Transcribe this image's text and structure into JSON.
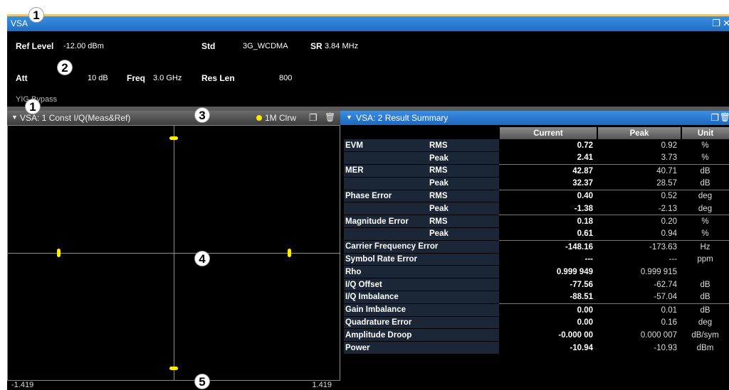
{
  "window": {
    "title": "VSA"
  },
  "header": {
    "ref_level_label": "Ref Level",
    "ref_level_value": "-12.00 dBm",
    "std_label": "Std",
    "std_value": "3G_WCDMA",
    "sr_label": "SR",
    "sr_value": "3.84 MHz",
    "att_label": "Att",
    "att_value": "10 dB",
    "freq_label": "Freq",
    "freq_value": "3.0 GHz",
    "res_len_label": "Res Len",
    "res_len_value": "800",
    "yig_text": "YIG Bypass"
  },
  "left_panel": {
    "title": "VSA: 1 Const I/Q(Meas&Ref)",
    "trace_tag": "1M Clrw",
    "x_min": "-1.419",
    "x_max": "1.419",
    "constellation_points": [
      {
        "i": 0.0,
        "q": 1.0
      },
      {
        "i": 0.0,
        "q": -1.0
      },
      {
        "i": -1.0,
        "q": 0.0
      },
      {
        "i": 1.0,
        "q": 0.0
      }
    ],
    "point_color": "#ffee00"
  },
  "right_panel": {
    "title": "VSA: 2 Result Summary",
    "columns": [
      "Current",
      "Peak",
      "Unit"
    ],
    "rows": [
      {
        "name": "EVM",
        "sub": "RMS",
        "current": "0.72",
        "peak": "0.92",
        "unit": "%"
      },
      {
        "name": "",
        "sub": "Peak",
        "current": "2.41",
        "peak": "3.73",
        "unit": "%"
      },
      {
        "name": "MER",
        "sub": "RMS",
        "current": "42.87",
        "peak": "40.71",
        "unit": "dB"
      },
      {
        "name": "",
        "sub": "Peak",
        "current": "32.37",
        "peak": "28.57",
        "unit": "dB"
      },
      {
        "name": "Phase Error",
        "sub": "RMS",
        "current": "0.40",
        "peak": "0.52",
        "unit": "deg"
      },
      {
        "name": "",
        "sub": "Peak",
        "current": "-1.38",
        "peak": "-2.13",
        "unit": "deg"
      },
      {
        "name": "Magnitude Error",
        "sub": "RMS",
        "current": "0.18",
        "peak": "0.20",
        "unit": "%"
      },
      {
        "name": "",
        "sub": "Peak",
        "current": "0.61",
        "peak": "0.94",
        "unit": "%"
      },
      {
        "name": "Carrier Frequency Error",
        "sub": "",
        "current": "-148.16",
        "peak": "-173.63",
        "unit": "Hz"
      },
      {
        "name": "Symbol Rate Error",
        "sub": "",
        "current": "---",
        "peak": "---",
        "unit": "ppm"
      },
      {
        "name": "Rho",
        "sub": "",
        "current": "0.999 949",
        "peak": "0.999 915",
        "unit": ""
      },
      {
        "name": "I/Q Offset",
        "sub": "",
        "current": "-77.56",
        "peak": "-62.74",
        "unit": "dB"
      },
      {
        "name": "I/Q Imbalance",
        "sub": "",
        "current": "-88.51",
        "peak": "-57.04",
        "unit": "dB"
      },
      {
        "name": "Gain Imbalance",
        "sub": "",
        "current": "0.00",
        "peak": "0.01",
        "unit": "dB"
      },
      {
        "name": "Quadrature Error",
        "sub": "",
        "current": "0.00",
        "peak": "0.16",
        "unit": "deg"
      },
      {
        "name": "Amplitude Droop",
        "sub": "",
        "current": "-0.000 00",
        "peak": "0.000 007",
        "unit": "dB/sym"
      },
      {
        "name": "Power",
        "sub": "",
        "current": "-10.94",
        "peak": "-10.93",
        "unit": "dBm"
      }
    ]
  },
  "callouts": [
    "1",
    "2",
    "1",
    "3",
    "4",
    "5"
  ]
}
